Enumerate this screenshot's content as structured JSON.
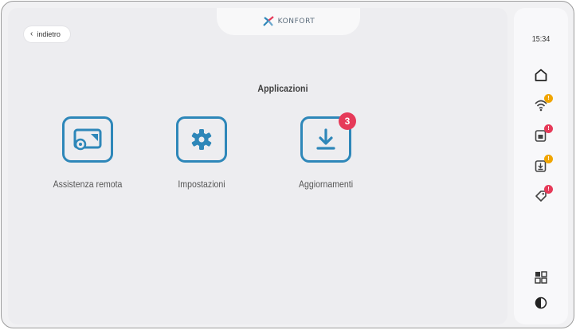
{
  "header": {
    "logo_text": "KONFORT",
    "back_label": "indietro"
  },
  "main": {
    "title": "Applicazioni",
    "apps": [
      {
        "label": "Assistenza remota",
        "icon": "remote-assistance-icon"
      },
      {
        "label": "Impostazioni",
        "icon": "gear-icon"
      },
      {
        "label": "Aggiornamenti",
        "icon": "download-icon",
        "badge": "3"
      }
    ]
  },
  "sidebar": {
    "time": "15:34",
    "items": [
      {
        "icon": "home-icon"
      },
      {
        "icon": "wifi-icon",
        "badge": "!",
        "badge_color": "#f0a500"
      },
      {
        "icon": "screen-icon",
        "badge": "!",
        "badge_color": "#e63a59"
      },
      {
        "icon": "download-icon",
        "badge": "!",
        "badge_color": "#f0a500"
      },
      {
        "icon": "tag-icon",
        "badge": "!",
        "badge_color": "#e63a59"
      },
      {
        "icon": "grid-icon"
      },
      {
        "icon": "contrast-icon"
      }
    ]
  },
  "colors": {
    "accent": "#2e87b9",
    "badge_red": "#e63a59",
    "badge_orange": "#f0a500"
  }
}
